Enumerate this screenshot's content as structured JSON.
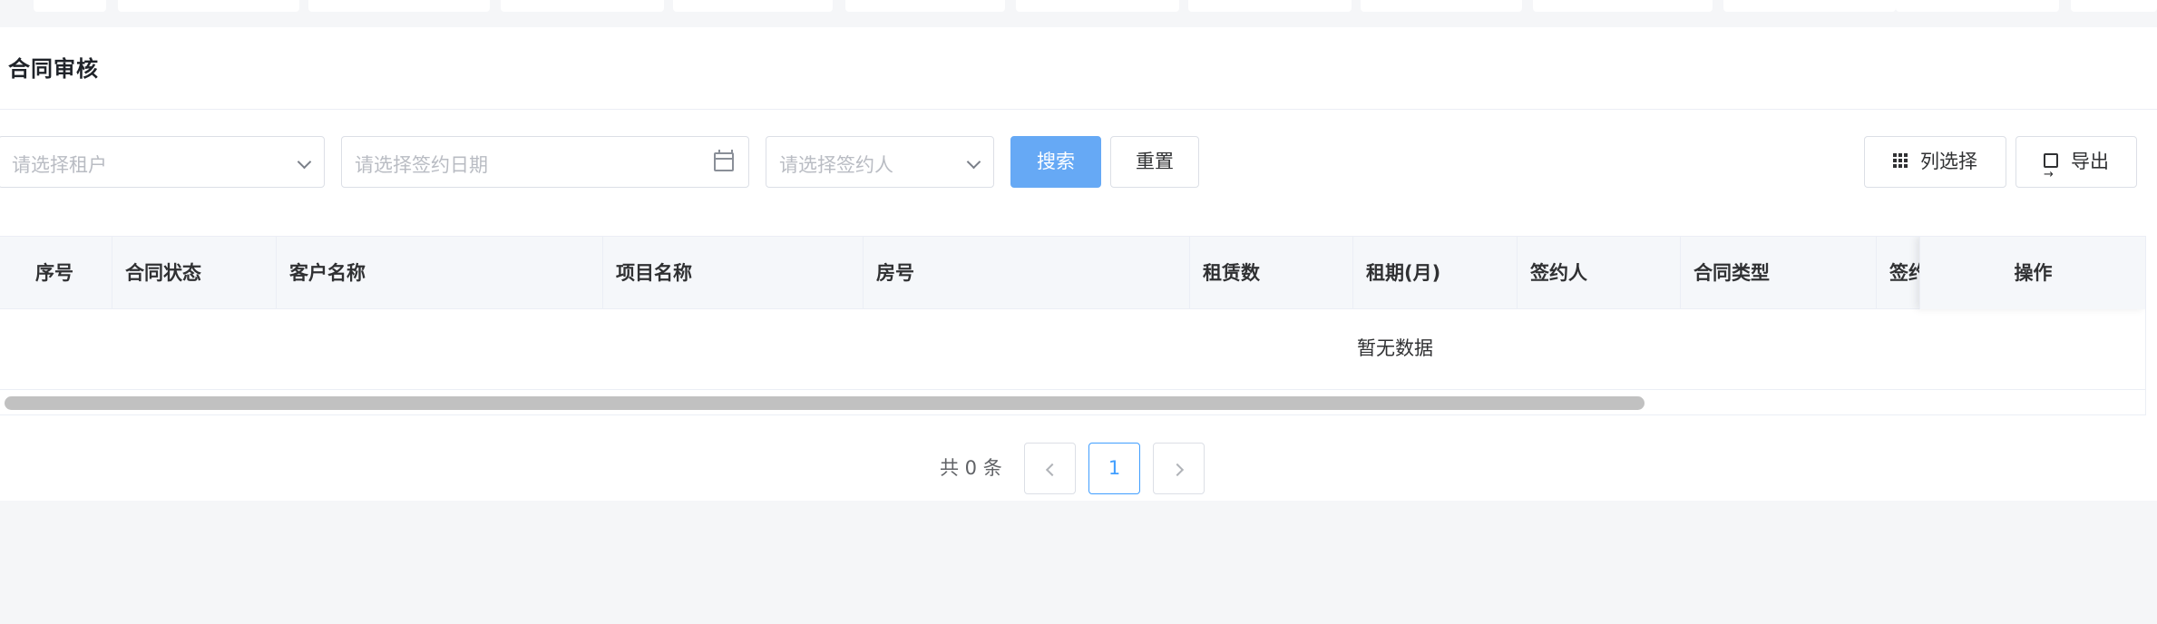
{
  "page": {
    "title": "合同审核"
  },
  "filters": {
    "tenant_placeholder": "请选择租户",
    "date_placeholder": "请选择签约日期",
    "signer_placeholder": "请选择签约人"
  },
  "buttons": {
    "search": "搜索",
    "reset": "重置",
    "column_select": "列选择",
    "export": "导出"
  },
  "table": {
    "columns": [
      "序号",
      "合同状态",
      "客户名称",
      "项目名称",
      "房号",
      "租赁数",
      "租期(月)",
      "签约人",
      "合同类型",
      "签约"
    ],
    "fixed_column": "操作",
    "empty_text": "暂无数据"
  },
  "pagination": {
    "total_text": "共 0 条",
    "current_page": "1"
  },
  "colors": {
    "primary": "#66a9f5",
    "active_page": "#409eff",
    "background": "#f5f6f8"
  },
  "icons": {
    "select_arrow": "chevron-down-icon",
    "date": "calendar-icon",
    "columns": "grid-icon",
    "export": "export-icon",
    "prev": "chevron-left-icon",
    "next": "chevron-right-icon"
  }
}
